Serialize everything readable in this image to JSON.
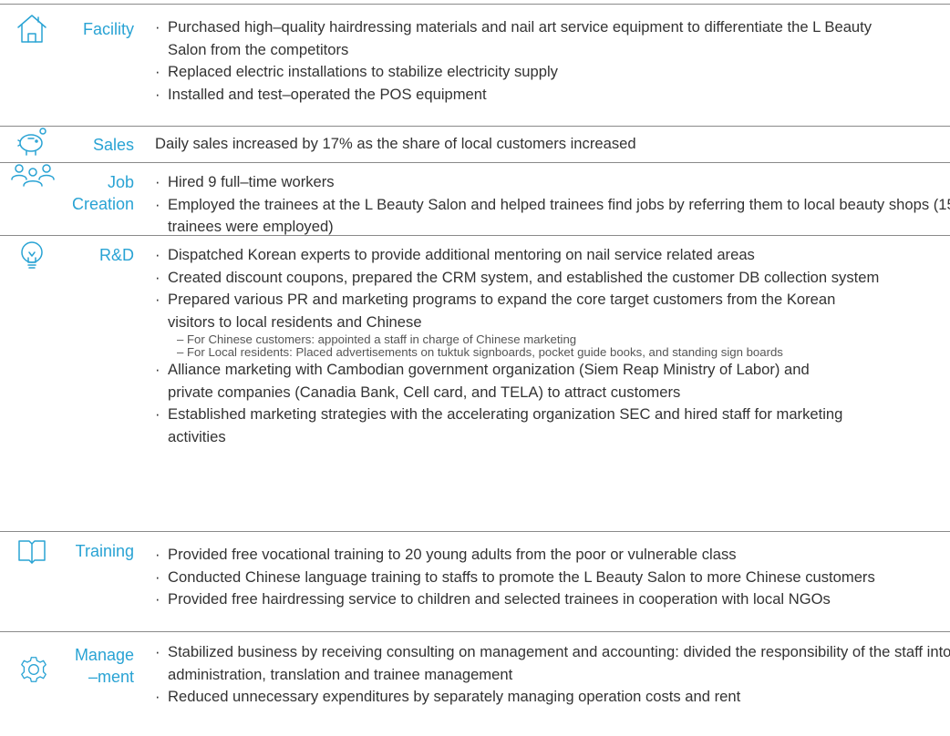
{
  "colors": {
    "accent": "#29a3d4",
    "text": "#333333",
    "rule": "#8a8a8a"
  },
  "sections": [
    {
      "icon": "house-icon",
      "label": "Facility",
      "items": [
        "Purchased high–quality hairdressing materials and nail art service equipment to differentiate the L Beauty Salon from the competitors",
        "Replaced electric installations to stabilize electricity supply",
        "Installed and test–operated the POS equipment"
      ]
    },
    {
      "icon": "piggy-bank-icon",
      "label": "Sales",
      "items": [
        "Daily sales increased by 17% as the share of local customers increased"
      ]
    },
    {
      "icon": "people-icon",
      "label": "Job Creation",
      "items": [
        "Hired 9 full–time workers",
        "Employed the trainees at the L Beauty Salon and helped trainees find jobs by referring them to local beauty shops (15 trainees were employed)"
      ]
    },
    {
      "icon": "lightbulb-icon",
      "label": "R&D",
      "items": [
        "Dispatched Korean experts to provide additional mentoring on nail service related areas",
        "Created discount coupons, prepared the CRM system, and established the customer DB collection system",
        "Prepared various PR and marketing programs to expand the core target customers from the Korean visitors to local residents and Chinese",
        "Alliance marketing with Cambodian government organization (Siem Reap Ministry of Labor) and private companies (Canadia Bank, Cell card, and TELA) to attract customers",
        "Established marketing strategies with the accelerating organization SEC and hired staff for marketing activities"
      ],
      "subitems": [
        "– For Chinese customers: appointed a staff in charge of Chinese marketing",
        "– For Local residents: Placed advertisements on tuktuk signboards, pocket guide books, and standing sign boards"
      ]
    },
    {
      "icon": "book-icon",
      "label": "Training",
      "items": [
        "Provided free vocational training to 20 young adults from the poor or vulnerable class",
        "Conducted Chinese language training to staffs to promote the L Beauty Salon to more Chinese customers",
        "Provided free hairdressing service to children and selected trainees in cooperation with local NGOs"
      ]
    },
    {
      "icon": "gear-icon",
      "label": "Manage –ment",
      "items": [
        "Stabilized business by receiving consulting on management and accounting: divided the responsibility of the staff into administration, translation and trainee management",
        "Reduced unnecessary expenditures by separately managing operation costs and rent"
      ]
    }
  ]
}
